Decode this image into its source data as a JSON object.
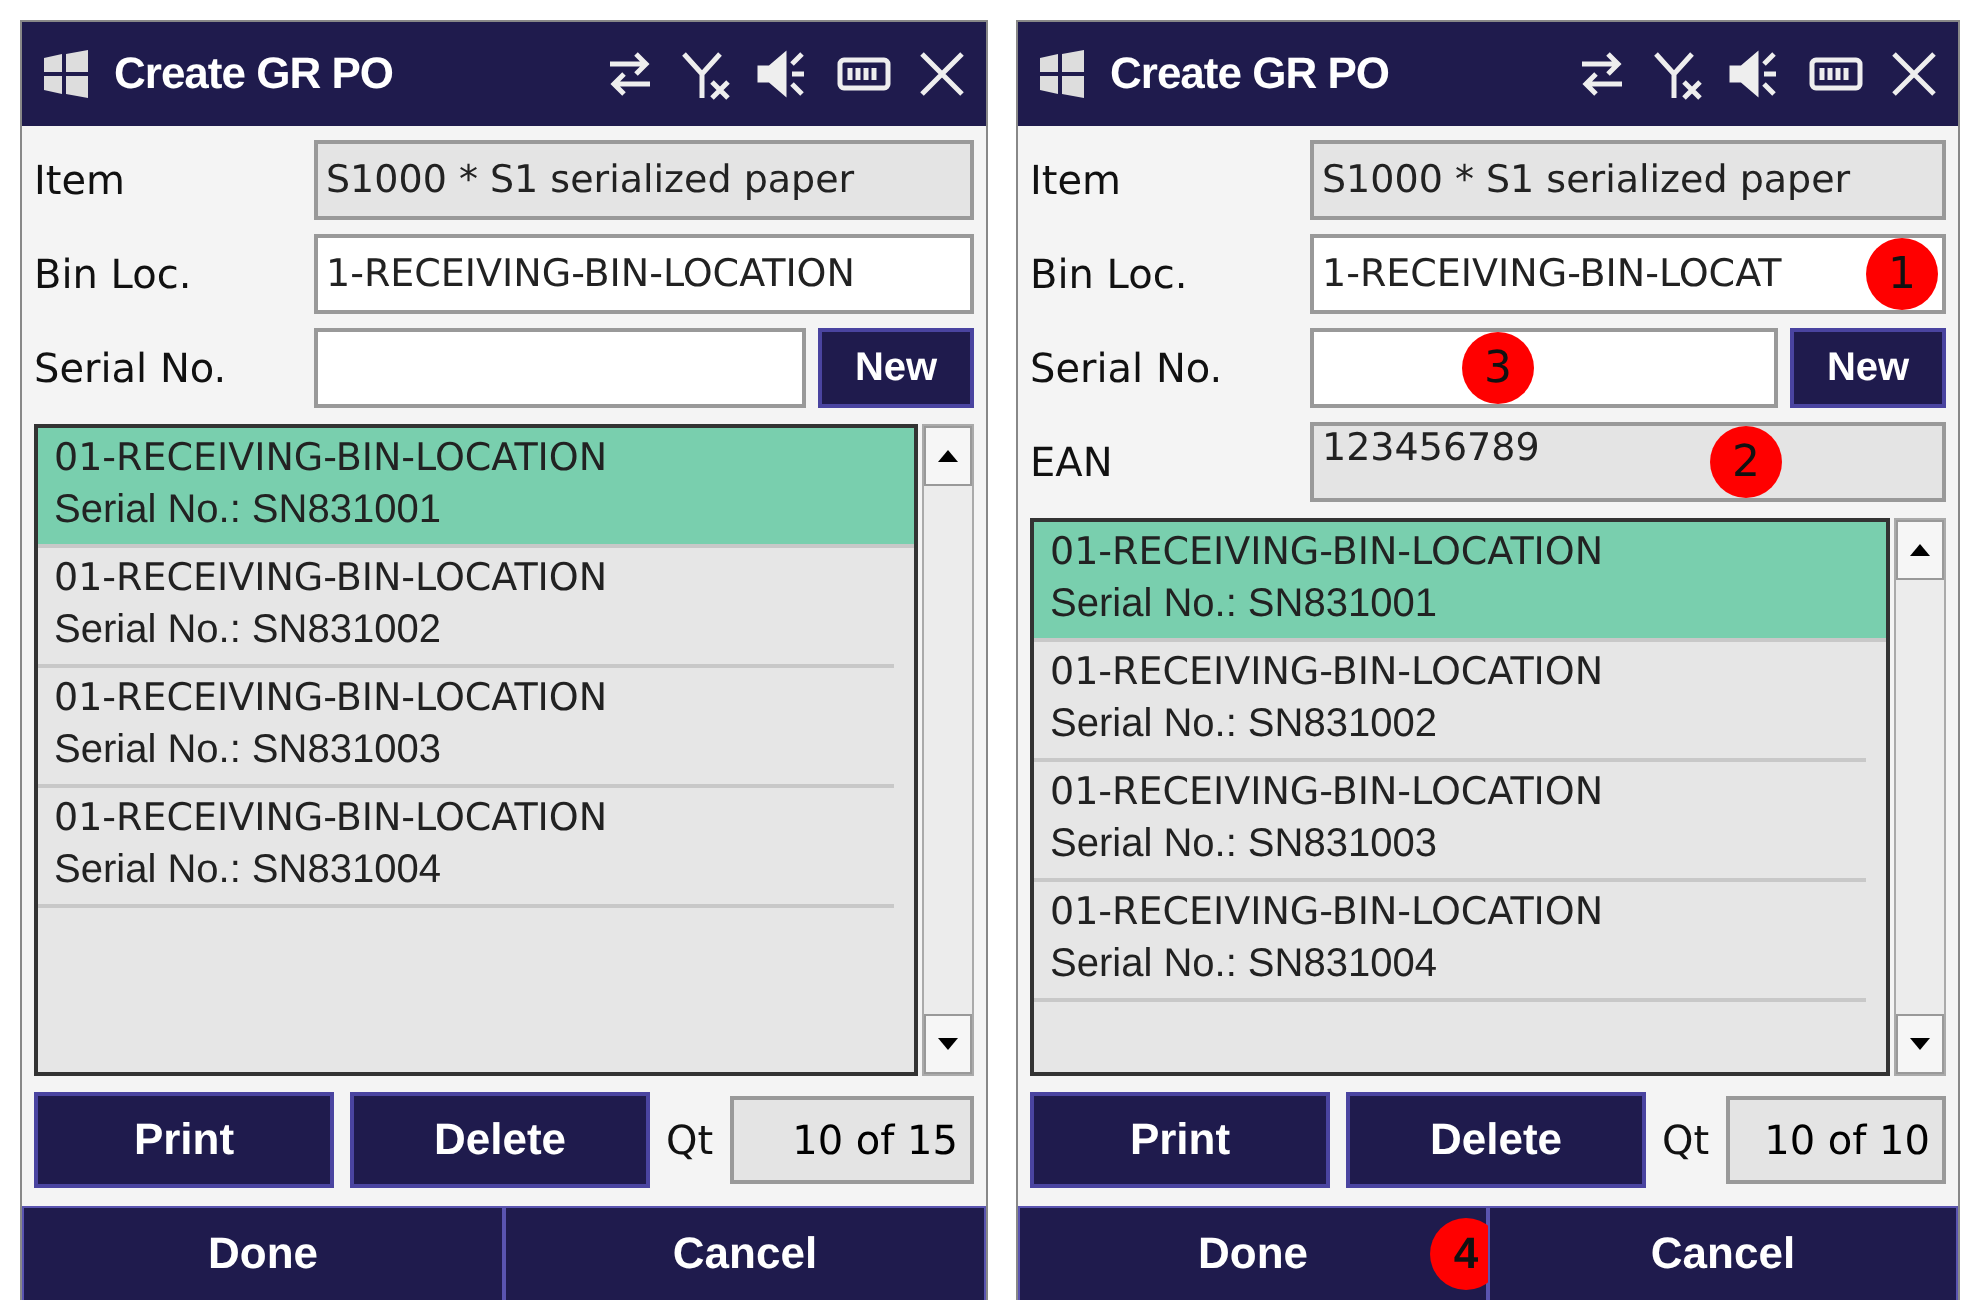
{
  "screens": [
    {
      "title": "Create GR PO",
      "fields": [
        {
          "kind": "readonly",
          "label": "Item",
          "value": "S1000 * S1 serialized paper"
        },
        {
          "kind": "input",
          "label": "Bin Loc.",
          "value": "1-RECEIVING-BIN-LOCATION"
        },
        {
          "kind": "input_button",
          "label": "Serial No.",
          "button": "New"
        }
      ],
      "list": [
        {
          "location": "01-RECEIVING-BIN-LOCATION",
          "serial": "Serial No.: SN831001",
          "selected": true
        },
        {
          "location": "01-RECEIVING-BIN-LOCATION",
          "serial": "Serial No.: SN831002",
          "selected": false
        },
        {
          "location": "01-RECEIVING-BIN-LOCATION",
          "serial": "Serial No.: SN831003",
          "selected": false
        },
        {
          "location": "01-RECEIVING-BIN-LOCATION",
          "serial": "Serial No.: SN831004",
          "selected": false
        }
      ],
      "actions": [
        "Print",
        "Delete"
      ],
      "qty_label": "Qt",
      "qty_value": "10 of 15",
      "bottom_buttons": [
        {
          "label": "Done"
        },
        {
          "label": "Cancel"
        }
      ]
    },
    {
      "title": "Create GR PO",
      "fields": [
        {
          "kind": "readonly",
          "label": "Item",
          "value": "S1000 * S1 serialized paper"
        },
        {
          "kind": "input",
          "label": "Bin Loc.",
          "value": "1-RECEIVING-BIN-LOCAT",
          "marker": "1"
        },
        {
          "kind": "input_button",
          "label": "Serial No.",
          "button": "New",
          "marker": "3"
        },
        {
          "kind": "readonly",
          "label": "EAN",
          "value": "123456789",
          "marker": "2"
        }
      ],
      "list": [
        {
          "location": "01-RECEIVING-BIN-LOCATION",
          "serial": "Serial No.: SN831001",
          "selected": true
        },
        {
          "location": "01-RECEIVING-BIN-LOCATION",
          "serial": "Serial No.: SN831002",
          "selected": false
        },
        {
          "location": "01-RECEIVING-BIN-LOCATION",
          "serial": "Serial No.: SN831003",
          "selected": false
        },
        {
          "location": "01-RECEIVING-BIN-LOCATION",
          "serial": "Serial No.: SN831004",
          "selected": false
        }
      ],
      "actions": [
        "Print",
        "Delete"
      ],
      "qty_label": "Qt",
      "qty_value": "10 of 10",
      "bottom_buttons": [
        {
          "label": "Done",
          "marker": "4"
        },
        {
          "label": "Cancel"
        }
      ]
    }
  ]
}
